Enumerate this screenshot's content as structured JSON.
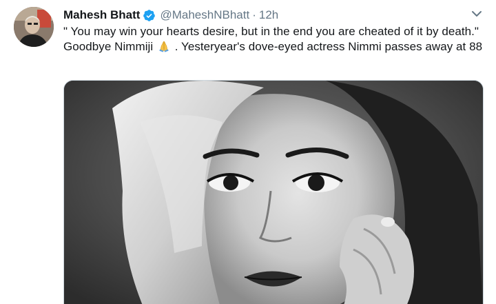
{
  "tweet": {
    "display_name": "Mahesh Bhatt",
    "handle": "@MaheshNBhatt",
    "separator": "·",
    "time": "12h",
    "text_part1": "\" You may win your hearts desire, but in the end you are cheated of it by death.\" Goodbye Nimmiji",
    "text_part2": ".  Yesteryear's dove-eyed actress Nimmi passes away at 88",
    "emoji": "folded-hands",
    "verified": true
  },
  "icons": {
    "verified": "verified-badge-icon",
    "more": "chevron-down-icon"
  },
  "colors": {
    "name": "#14171a",
    "secondary": "#657786",
    "verified_blue": "#1da1f2",
    "border": "#ccd6dd"
  },
  "media": {
    "type": "black-and-white photograph"
  }
}
